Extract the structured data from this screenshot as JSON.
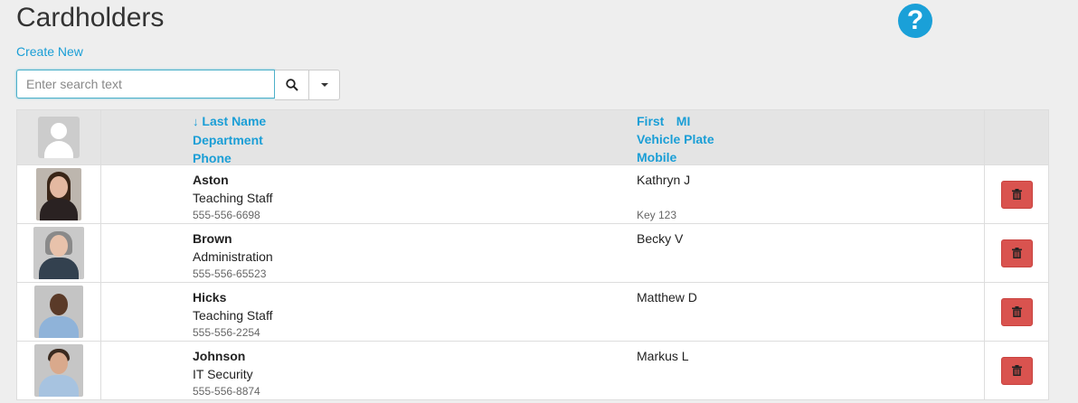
{
  "page": {
    "title": "Cardholders",
    "create_new": "Create New",
    "help_glyph": "?",
    "help_icon": "question-circle-icon"
  },
  "search": {
    "placeholder": "Enter search text",
    "value": "",
    "search_icon": "magnifier-icon",
    "dropdown_icon": "caret-down-icon"
  },
  "table": {
    "headers": {
      "last_name": "Last Name",
      "sort_arrow": "↓",
      "department": "Department",
      "phone": "Phone",
      "first": "First",
      "mi": "MI",
      "vehicle_plate": "Vehicle Plate",
      "mobile": "Mobile"
    },
    "rows": [
      {
        "last": "Aston",
        "dept": "Teaching Staff",
        "phone": "555-556-6698",
        "first_mi": "Kathryn J",
        "plate": "",
        "mobile": "Key 123"
      },
      {
        "last": "Brown",
        "dept": "Administration",
        "phone": "555-556-65523",
        "first_mi": "Becky V",
        "plate": "",
        "mobile": ""
      },
      {
        "last": "Hicks",
        "dept": "Teaching Staff",
        "phone": "555-556-2254",
        "first_mi": "Matthew D",
        "plate": "",
        "mobile": ""
      },
      {
        "last": "Johnson",
        "dept": "IT Security",
        "phone": "555-556-8874",
        "first_mi": "Markus L",
        "plate": "",
        "mobile": ""
      }
    ]
  },
  "colors": {
    "accent": "#1a9ed6",
    "delete": "#d9534f",
    "background": "#eeeeee",
    "header_bg": "#e4e4e4"
  }
}
